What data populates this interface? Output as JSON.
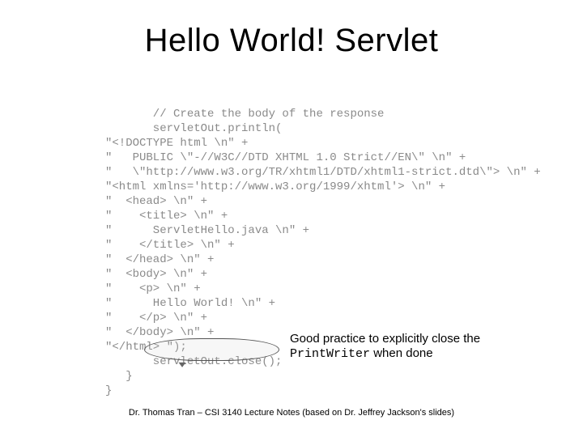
{
  "title": "Hello World! Servlet",
  "code": "       // Create the body of the response\n       servletOut.println(\n\"<!DOCTYPE html \\n\" +\n\"   PUBLIC \\\"-//W3C//DTD XHTML 1.0 Strict//EN\\\" \\n\" +\n\"   \\\"http://www.w3.org/TR/xhtml1/DTD/xhtml1-strict.dtd\\\"> \\n\" +\n\"<html xmlns='http://www.w3.org/1999/xhtml'> \\n\" +\n\"  <head> \\n\" +\n\"    <title> \\n\" +\n\"      ServletHello.java \\n\" +\n\"    </title> \\n\" +\n\"  </head> \\n\" +\n\"  <body> \\n\" +\n\"    <p> \\n\" +\n\"      Hello World! \\n\" +\n\"    </p> \\n\" +\n\"  </body> \\n\" +\n\"</html> \");\n       servletOut.close();\n   }\n}",
  "callout": {
    "prefix": "Good practice to explicitly close the ",
    "mono": "PrintWriter",
    "suffix": " when done"
  },
  "footer": "Dr. Thomas Tran – CSI 3140 Lecture Notes (based on Dr. Jeffrey Jackson's slides)",
  "chart_data": null
}
